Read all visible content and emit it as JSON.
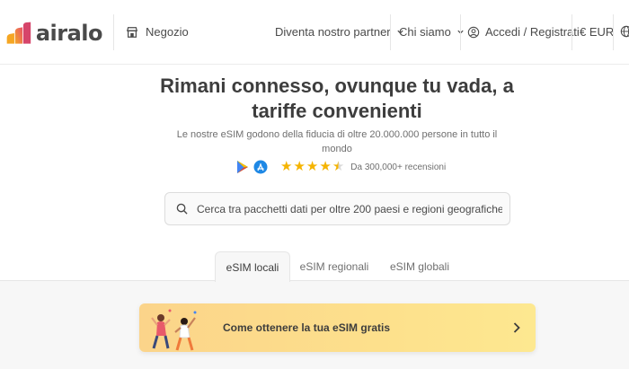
{
  "brand": {
    "name": "airalo"
  },
  "nav": {
    "store": "Negozio",
    "partner": "Diventa nostro partner",
    "about": "Chi siamo",
    "login": "Accedi / Registrati",
    "currency": "€ EUR"
  },
  "hero": {
    "title_line1": "Rimani connesso, ovunque tu vada, a",
    "title_line2": "tariffe convenienti",
    "subtitle_line1": "Le nostre eSIM godono della fiducia di oltre 20.000.000 persone in tutto il",
    "subtitle_line2": "mondo",
    "reviews": "Da 300,000+ recensioni",
    "rating_stars": 4.5
  },
  "search": {
    "placeholder": "Cerca tra pacchetti dati per oltre 200 paesi e regioni geografiche"
  },
  "tabs": [
    {
      "label": "eSIM locali",
      "active": true
    },
    {
      "label": "eSIM regionali",
      "active": false
    },
    {
      "label": "eSIM globali",
      "active": false
    }
  ],
  "banner": {
    "text": "Come ottenere la tua eSIM gratis"
  },
  "icons": {
    "store": "store-icon",
    "chevron": "chevron-down-icon",
    "user": "user-icon",
    "globe": "globe-icon",
    "search": "search-icon",
    "play": "google-play-icon",
    "appstore": "app-store-icon",
    "arrow": "chevron-right-icon"
  },
  "colors": {
    "star": "#f5b400",
    "banner": "#fde08c",
    "logo": "#e8546c"
  }
}
